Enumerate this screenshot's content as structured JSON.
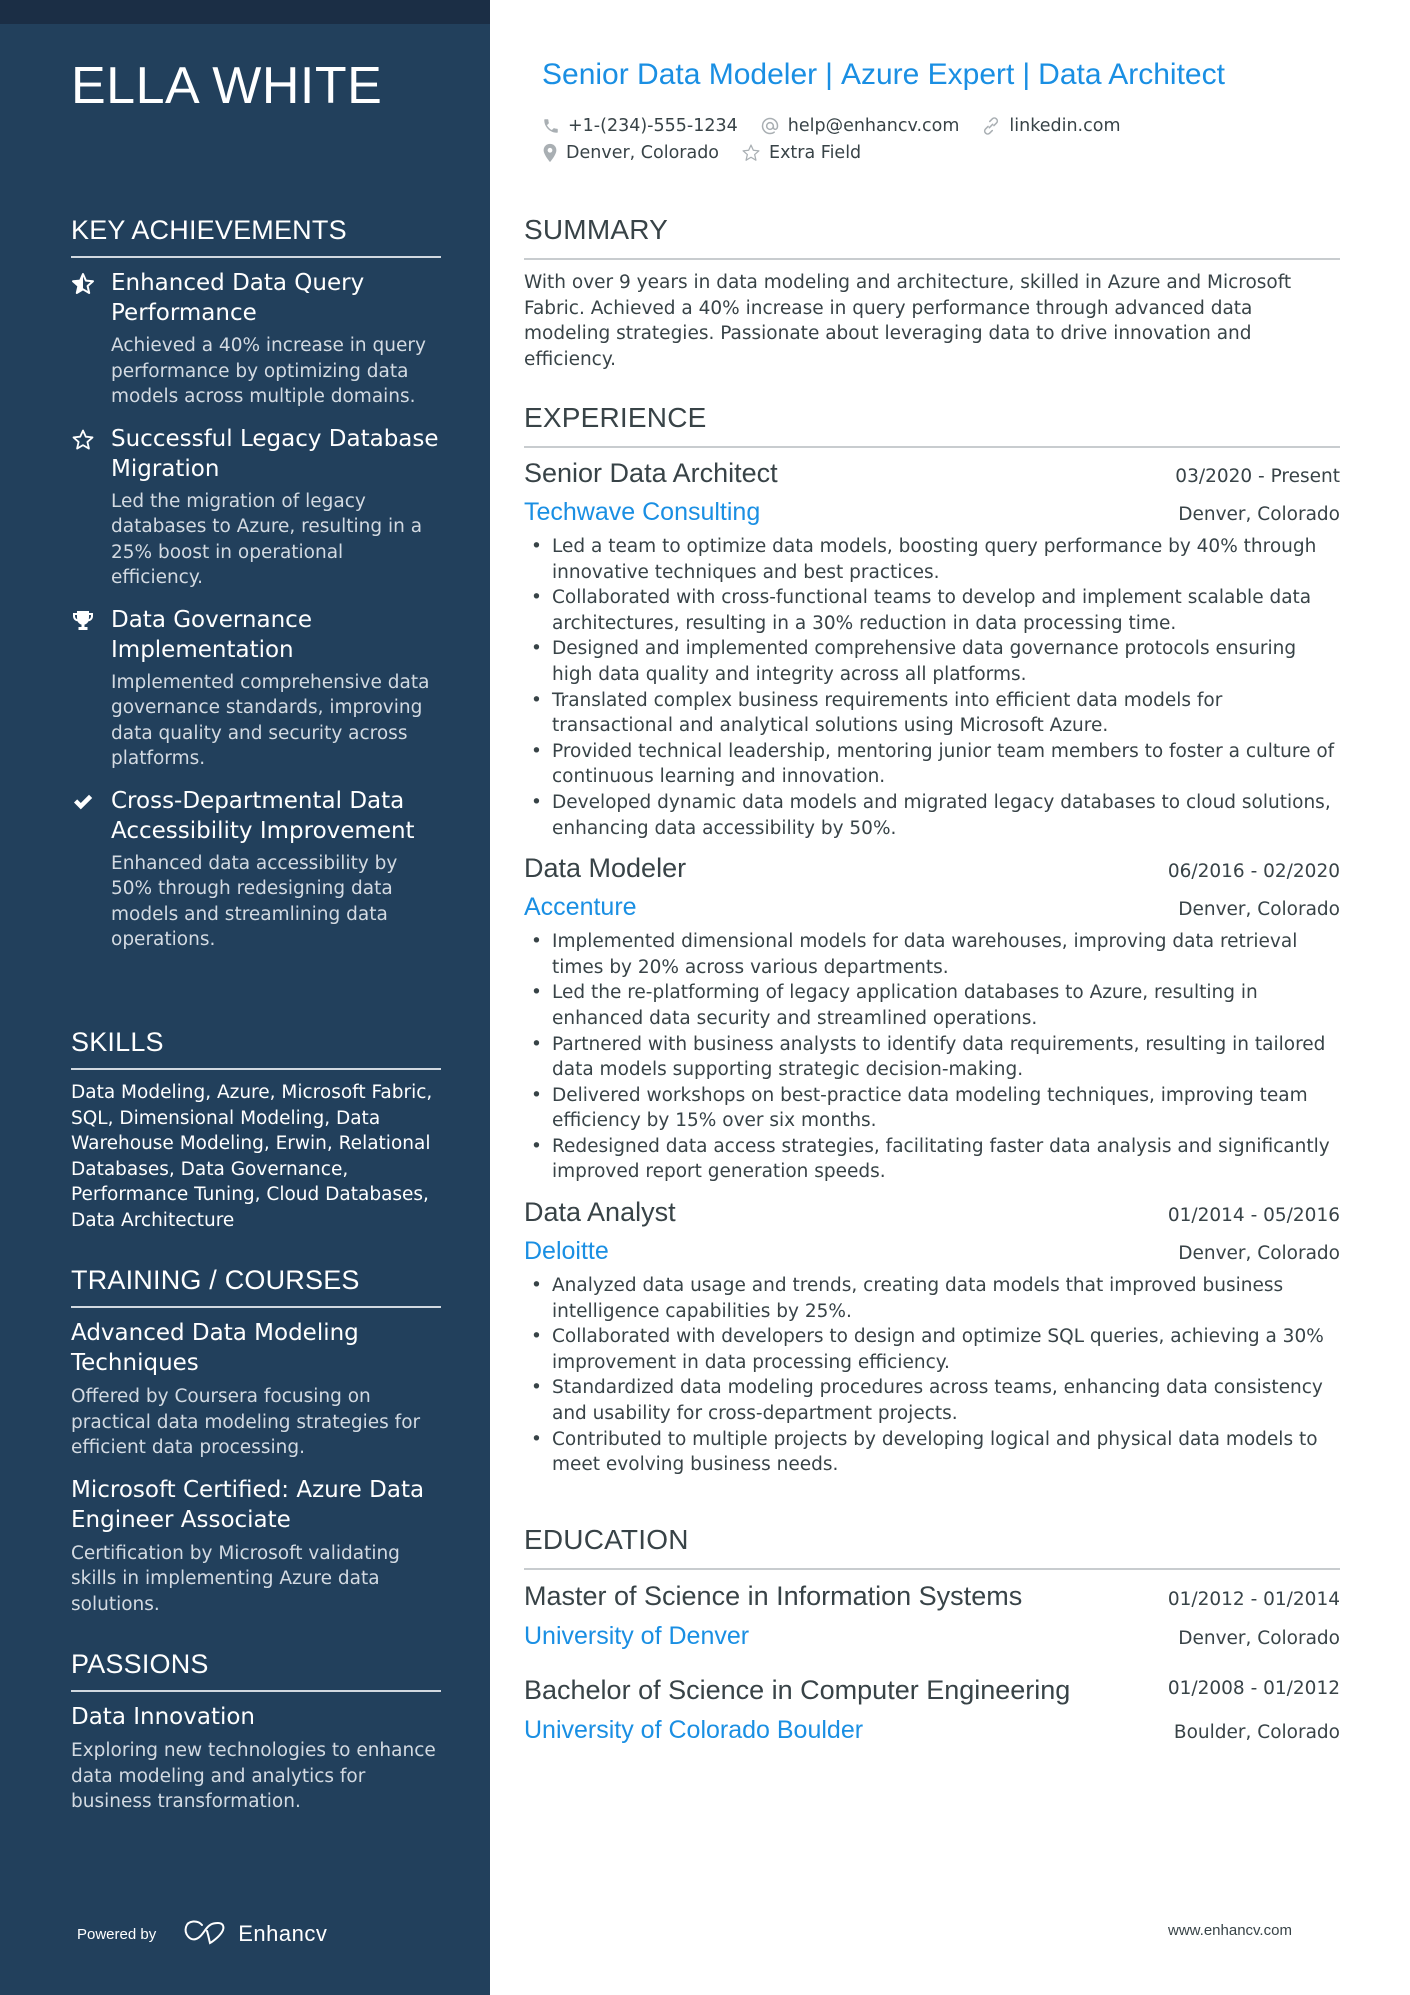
{
  "person": {
    "name": "ELLA WHITE",
    "headline_parts": [
      "Senior Data Modeler",
      "Azure Expert",
      "Data Architect"
    ],
    "headline_separator": "|",
    "contacts": {
      "phone": {
        "icon": "phone-icon",
        "value": "+1-(234)-555-1234"
      },
      "email": {
        "icon": "at-icon",
        "value": "help@enhancv.com"
      },
      "link": {
        "icon": "link-icon",
        "value": "linkedin.com"
      },
      "location": {
        "icon": "map-pin-icon",
        "value": "Denver, Colorado"
      },
      "extra": {
        "icon": "star-outline-icon",
        "value": "Extra Field"
      }
    }
  },
  "colors": {
    "sidebar_bg": "#22405c",
    "sidebar_topband": "#1b2e45",
    "accent": "#1a8fe3",
    "text": "#384347"
  },
  "sidebar": {
    "achievements": {
      "heading": "KEY ACHIEVEMENTS",
      "items": [
        {
          "icon": "star-half-icon",
          "title": "Enhanced Data Query Performance",
          "description": "Achieved a 40% increase in query performance by optimizing data models across multiple domains."
        },
        {
          "icon": "star-outline-icon",
          "title": "Successful Legacy Database Migration",
          "description": "Led the migration of legacy databases to Azure, resulting in a 25% boost in operational efficiency."
        },
        {
          "icon": "trophy-icon",
          "title": "Data Governance Implementation",
          "description": "Implemented comprehensive data governance standards, improving data quality and security across platforms."
        },
        {
          "icon": "checkmark-icon",
          "title": "Cross-Departmental Data Accessibility Improvement",
          "description": "Enhanced data accessibility by 50% through redesigning data models and streamlining data operations."
        }
      ]
    },
    "skills": {
      "heading": "SKILLS",
      "text": "Data Modeling, Azure, Microsoft Fabric, SQL, Dimensional Modeling, Data Warehouse Modeling, Erwin, Relational Databases, Data Governance, Performance Tuning, Cloud Databases, Data Architecture"
    },
    "training": {
      "heading": "TRAINING / COURSES",
      "items": [
        {
          "title": "Advanced Data Modeling Techniques",
          "description": "Offered by Coursera focusing on practical data modeling strategies for efficient data processing."
        },
        {
          "title": "Microsoft Certified: Azure Data Engineer Associate",
          "description": "Certification by Microsoft validating skills in implementing Azure data solutions."
        }
      ]
    },
    "passions": {
      "heading": "PASSIONS",
      "items": [
        {
          "title": "Data Innovation",
          "description": "Exploring new technologies to enhance data modeling and analytics for business transformation."
        }
      ]
    },
    "footer": {
      "powered_by": "Powered by",
      "brand": "Enhancv"
    }
  },
  "main": {
    "summary": {
      "heading": "SUMMARY",
      "text": "With over 9 years in data modeling and architecture, skilled in Azure and Microsoft Fabric. Achieved a 40% increase in query performance through advanced data modeling strategies. Passionate about leveraging data to drive innovation and efficiency."
    },
    "experience": {
      "heading": "EXPERIENCE",
      "jobs": [
        {
          "title": "Senior Data Architect",
          "dates": "03/2020 - Present",
          "company": "Techwave Consulting",
          "location": "Denver, Colorado",
          "bullets": [
            "Led a team to optimize data models, boosting query performance by 40% through innovative techniques and best practices.",
            "Collaborated with cross-functional teams to develop and implement scalable data architectures, resulting in a 30% reduction in data processing time.",
            "Designed and implemented comprehensive data governance protocols ensuring high data quality and integrity across all platforms.",
            "Translated complex business requirements into efficient data models for transactional and analytical solutions using Microsoft Azure.",
            "Provided technical leadership, mentoring junior team members to foster a culture of continuous learning and innovation.",
            "Developed dynamic data models and migrated legacy databases to cloud solutions, enhancing data accessibility by 50%."
          ]
        },
        {
          "title": "Data Modeler",
          "dates": "06/2016 - 02/2020",
          "company": "Accenture",
          "location": "Denver, Colorado",
          "bullets": [
            "Implemented dimensional models for data warehouses, improving data retrieval times by 20% across various departments.",
            "Led the re-platforming of legacy application databases to Azure, resulting in enhanced data security and streamlined operations.",
            "Partnered with business analysts to identify data requirements, resulting in tailored data models supporting strategic decision-making.",
            "Delivered workshops on best-practice data modeling techniques, improving team efficiency by 15% over six months.",
            "Redesigned data access strategies, facilitating faster data analysis and significantly improved report generation speeds."
          ]
        },
        {
          "title": "Data Analyst",
          "dates": "01/2014 - 05/2016",
          "company": "Deloitte",
          "location": "Denver, Colorado",
          "bullets": [
            "Analyzed data usage and trends, creating data models that improved business intelligence capabilities by 25%.",
            "Collaborated with developers to design and optimize SQL queries, achieving a 30% improvement in data processing efficiency.",
            "Standardized data modeling procedures across teams, enhancing data consistency and usability for cross-department projects.",
            "Contributed to multiple projects by developing logical and physical data models to meet evolving business needs."
          ]
        }
      ]
    },
    "education": {
      "heading": "EDUCATION",
      "items": [
        {
          "degree": "Master of Science in Information Systems",
          "dates": "01/2012 - 01/2014",
          "school": "University of Denver",
          "location": "Denver, Colorado"
        },
        {
          "degree": "Bachelor of Science in Computer Engineering",
          "dates": "01/2008 - 01/2012",
          "school": "University of Colorado Boulder",
          "location": "Boulder, Colorado"
        }
      ]
    },
    "footer": {
      "website": "www.enhancv.com"
    }
  }
}
